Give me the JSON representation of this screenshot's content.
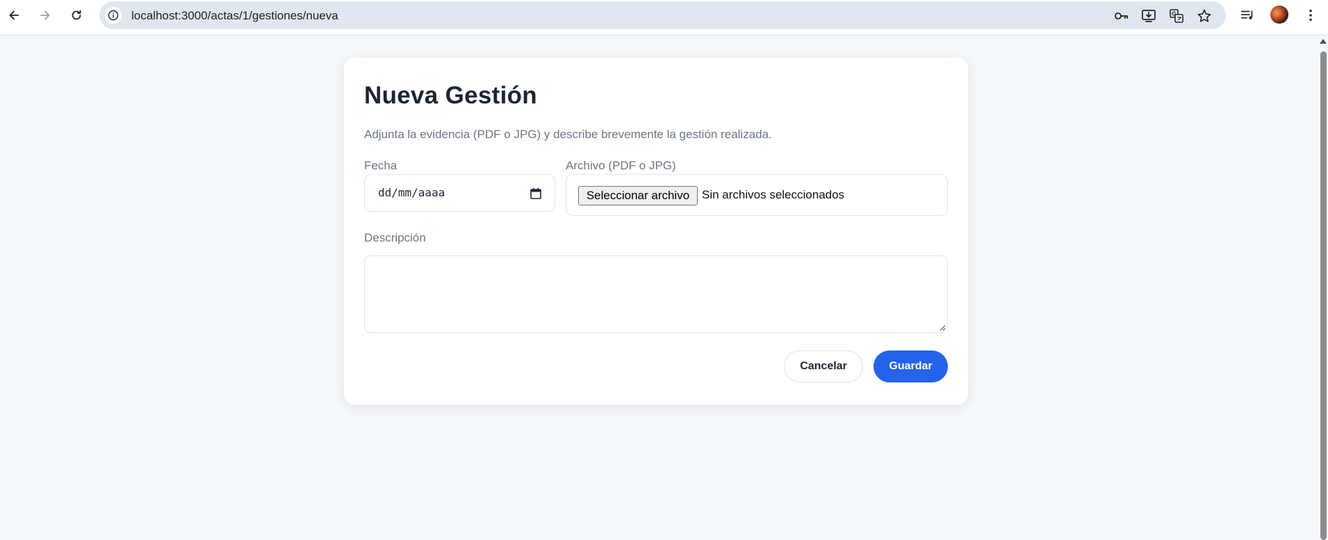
{
  "browser": {
    "url": "localhost:3000/actas/1/gestiones/nueva",
    "icons": [
      "back-arrow-icon",
      "forward-arrow-icon",
      "reload-icon",
      "site-info-icon",
      "password-key-icon",
      "install-app-icon",
      "translate-icon",
      "bookmark-star-icon",
      "media-queue-icon",
      "profile-avatar",
      "more-menu-icon"
    ]
  },
  "form": {
    "title": "Nueva Gestión",
    "subtitle": "Adjunta la evidencia (PDF o JPG) y describe brevemente la gestión realizada.",
    "date_label": "Fecha",
    "date_placeholder": "dd/mm/aaaa",
    "file_label": "Archivo (PDF o JPG)",
    "file_button": "Seleccionar archivo",
    "file_status": "Sin archivos seleccionados",
    "description_label": "Descripción",
    "description_value": "",
    "cancel_label": "Cancelar",
    "save_label": "Guardar"
  },
  "colors": {
    "accent": "#2563eb",
    "background": "#f4f7fb",
    "title": "#1b2536",
    "muted": "#6b7686"
  }
}
